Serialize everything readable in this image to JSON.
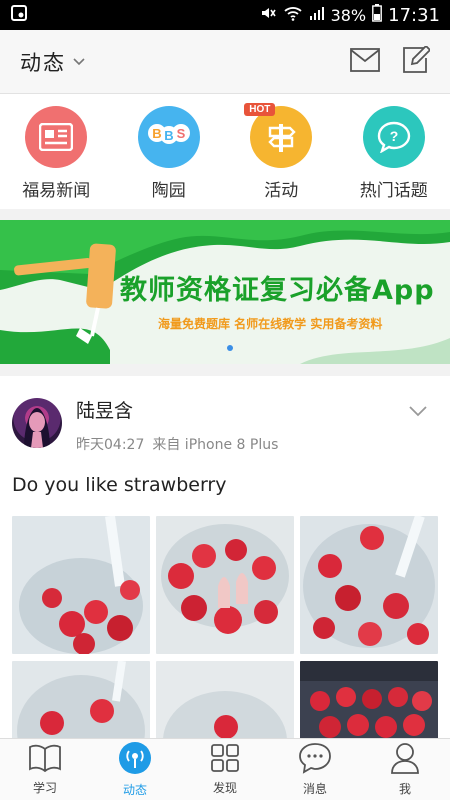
{
  "status_bar": {
    "battery": "38%",
    "time": "17:31"
  },
  "header": {
    "title": "动态"
  },
  "quick_entries": [
    {
      "label": "福易新闻",
      "icon": "news-icon",
      "color": "#f07070"
    },
    {
      "label": "陶园",
      "icon": "bbs-icon",
      "color": "#46b4ef"
    },
    {
      "label": "活动",
      "icon": "signpost-icon",
      "color": "#f6b530",
      "badge": "HOT"
    },
    {
      "label": "热门话题",
      "icon": "chat-question-icon",
      "color": "#2cc7bd"
    }
  ],
  "banner": {
    "title": "教师资格证复习必备App",
    "subtitle": "海量免费题库  名师在线教学  实用备考资料"
  },
  "post": {
    "author": "陆昱含",
    "time": "昨天04:27",
    "source": "来自 iPhone 8 Plus",
    "text": "Do you like strawberry"
  },
  "tabs": [
    {
      "label": "学习",
      "icon": "book-icon",
      "active": false
    },
    {
      "label": "动态",
      "icon": "broadcast-icon",
      "active": true
    },
    {
      "label": "发现",
      "icon": "grid-icon",
      "active": false
    },
    {
      "label": "消息",
      "icon": "chat-bubble-icon",
      "active": false
    },
    {
      "label": "我",
      "icon": "person-icon",
      "active": false
    }
  ],
  "colors": {
    "accent": "#1e9be6",
    "banner_green": "#1aa12a",
    "banner_orange": "#f19a1c"
  }
}
